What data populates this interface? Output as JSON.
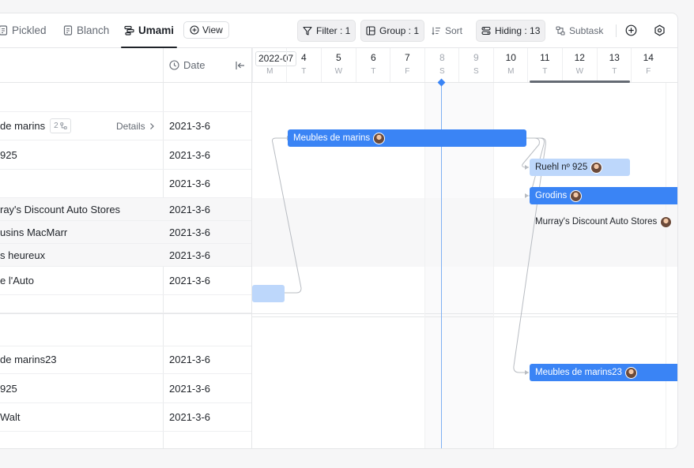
{
  "toolbar": {
    "tabs": [
      {
        "label": "Pickled",
        "active": false
      },
      {
        "label": "Blanch",
        "active": false
      },
      {
        "label": "Umami",
        "active": true
      }
    ],
    "view_label": "View",
    "filter_label": "Filter : 1",
    "group_label": "Group : 1",
    "sort_label": "Sort",
    "hiding_label": "Hiding : 13",
    "subtask_label": "Subtask"
  },
  "grid": {
    "date_header": "Date",
    "details_label": "Details",
    "subtask_count": "2",
    "rows": [
      {
        "name": "de marins",
        "date": "2021-3-6"
      },
      {
        "name": "925",
        "date": "2021-3-6"
      },
      {
        "name": "",
        "date": "2021-3-6"
      },
      {
        "name": "ray's Discount Auto Stores",
        "date": "2021-3-6"
      },
      {
        "name": "usins MacMarr",
        "date": "2021-3-6"
      },
      {
        "name": "s heureux",
        "date": "2021-3-6"
      },
      {
        "name": "e l'Auto",
        "date": "2021-3-6"
      },
      {
        "name": "de marins23",
        "date": "2021-3-6"
      },
      {
        "name": "925",
        "date": "2021-3-6"
      },
      {
        "name": "Walt",
        "date": "2021-3-6"
      }
    ]
  },
  "gantt": {
    "month_label": "2022-07",
    "days": [
      {
        "num": "4",
        "wd": "T"
      },
      {
        "num": "5",
        "wd": "W"
      },
      {
        "num": "6",
        "wd": "T"
      },
      {
        "num": "7",
        "wd": "F"
      },
      {
        "num": "8",
        "wd": "S"
      },
      {
        "num": "9",
        "wd": "S"
      },
      {
        "num": "10",
        "wd": "M"
      },
      {
        "num": "11",
        "wd": "T"
      },
      {
        "num": "12",
        "wd": "W"
      },
      {
        "num": "13",
        "wd": "T"
      },
      {
        "num": "14",
        "wd": "F"
      }
    ],
    "first_weekday": "M",
    "bars": [
      {
        "label": "Meubles de marins"
      },
      {
        "label": "Ruehl nº 925"
      },
      {
        "label": "Grodins"
      },
      {
        "label": "Murray's Discount Auto Stores"
      },
      {
        "label": "Meubles de marins23"
      }
    ]
  },
  "colors": {
    "bar_primary": "#3a84f5",
    "bar_light": "#bdd7fb",
    "today_line": "#7fb0f3"
  }
}
